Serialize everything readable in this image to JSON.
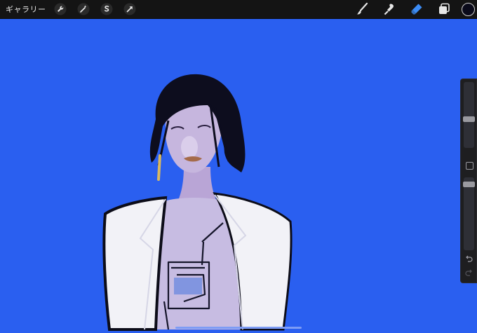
{
  "topbar": {
    "gallery_label": "ギャラリー",
    "left_tools": [
      {
        "name": "actions",
        "icon": "wrench-icon"
      },
      {
        "name": "adjustments",
        "icon": "magic-wand-icon"
      },
      {
        "name": "selection",
        "icon": "selection-s-icon"
      },
      {
        "name": "transform",
        "icon": "transform-arrow-icon"
      }
    ],
    "right_tools": [
      {
        "name": "brush",
        "icon": "brush-icon",
        "active": false
      },
      {
        "name": "smudge",
        "icon": "smudge-icon",
        "active": false
      },
      {
        "name": "eraser",
        "icon": "eraser-icon",
        "active": true
      },
      {
        "name": "layers",
        "icon": "layers-icon",
        "active": false
      }
    ],
    "current_color": "#0a0a1a"
  },
  "colors": {
    "canvas_background": "#2a5ff0",
    "toolbar": "#141414",
    "active_tool": "#3c8cf5",
    "inactive_tool": "#e6e6e6"
  },
  "sidebar": {
    "brush_size_level": 0.55,
    "opacity_level": 0.1
  }
}
